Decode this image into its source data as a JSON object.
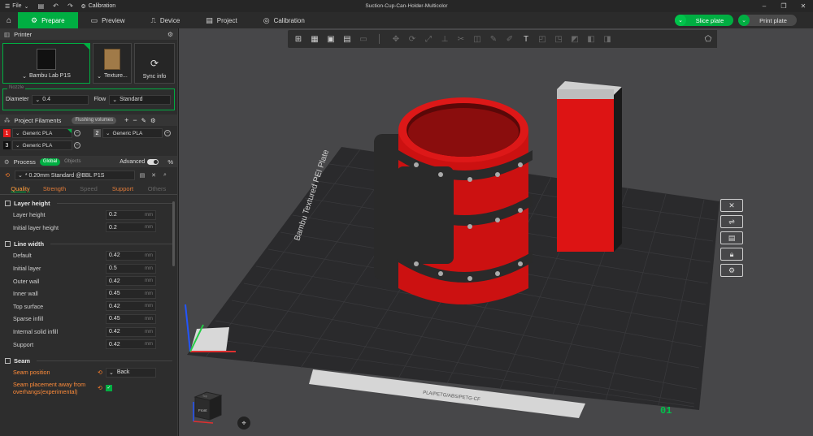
{
  "titlebar": {
    "file_menu": "File",
    "calibration_shortcut": "Calibration",
    "document_title": "Suction-Cup-Can-Holder-Multicolor"
  },
  "tabs": [
    {
      "label": "Prepare",
      "icon": "prepare-icon",
      "active": true
    },
    {
      "label": "Preview",
      "icon": "preview-icon"
    },
    {
      "label": "Device",
      "icon": "device-icon"
    },
    {
      "label": "Project",
      "icon": "project-icon"
    },
    {
      "label": "Calibration",
      "icon": "calibration-icon"
    }
  ],
  "actions": {
    "slice_label": "Slice plate",
    "print_label": "Print plate"
  },
  "printer_section": {
    "title": "Printer",
    "printer_name": "Bambu Lab P1S",
    "plate_name": "Texture...",
    "sync_label": "Sync info",
    "group_label": "Nozzle",
    "diameter_label": "Diameter",
    "diameter_value": "0.4",
    "flow_label": "Flow",
    "flow_value": "Standard"
  },
  "filaments": {
    "title": "Project Filaments",
    "flushing_label": "Flushing volumes",
    "slots": [
      {
        "number": "1",
        "name": "Generic PLA",
        "color": "#e51b1b"
      },
      {
        "number": "2",
        "name": "Generic PLA",
        "color": "#555555"
      },
      {
        "number": "3",
        "name": "Generic PLA",
        "color": "#111111"
      }
    ]
  },
  "process": {
    "title": "Process",
    "global_label": "Global",
    "objects_label": "Objects",
    "advanced_label": "Advanced",
    "preset": "* 0.20mm Standard @BBL P1S",
    "tabs": [
      "Quality",
      "Strength",
      "Speed",
      "Support",
      "Others"
    ],
    "groups": [
      {
        "title": "Layer height",
        "rows": [
          {
            "label": "Layer height",
            "value": "0.2",
            "unit": "mm"
          },
          {
            "label": "Initial layer height",
            "value": "0.2",
            "unit": "mm"
          }
        ]
      },
      {
        "title": "Line width",
        "rows": [
          {
            "label": "Default",
            "value": "0.42",
            "unit": "mm"
          },
          {
            "label": "Initial layer",
            "value": "0.5",
            "unit": "mm"
          },
          {
            "label": "Outer wall",
            "value": "0.42",
            "unit": "mm"
          },
          {
            "label": "Inner wall",
            "value": "0.45",
            "unit": "mm"
          },
          {
            "label": "Top surface",
            "value": "0.42",
            "unit": "mm"
          },
          {
            "label": "Sparse infill",
            "value": "0.45",
            "unit": "mm"
          },
          {
            "label": "Internal solid infill",
            "value": "0.42",
            "unit": "mm"
          },
          {
            "label": "Support",
            "value": "0.42",
            "unit": "mm"
          }
        ]
      },
      {
        "title": "Seam",
        "seam_position_label": "Seam position",
        "seam_position_value": "Back",
        "seam_away_label_1": "Seam placement away from",
        "seam_away_label_2": "overhangs(experimental)"
      }
    ]
  },
  "viewport": {
    "plate_brand_text": "Bambu Textured PEI Plate",
    "plate_number": "01",
    "plate_label_strip": "PLA/PETG/ABS/PETG-CF",
    "cube_top": "Top",
    "cube_front": "Front"
  }
}
